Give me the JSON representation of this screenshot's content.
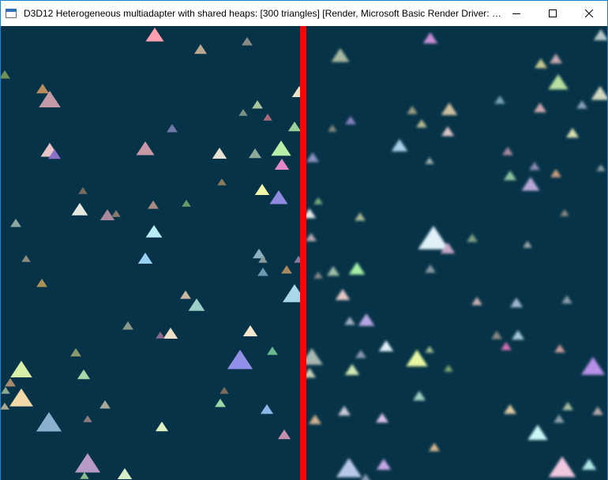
{
  "window": {
    "title": "D3D12 Heterogeneous multiadapter with shared heaps: [300 triangles] [Render, Microsoft Basic Render Driver: 23..."
  },
  "icons": {
    "app": "app-icon",
    "minimize": "minimize-icon",
    "maximize": "maximize-icon",
    "close": "close-icon"
  },
  "colors": {
    "background": "#063347",
    "divider": "#ff0000",
    "titlebar": "#ffffff",
    "window_border": "#1883d7"
  }
}
